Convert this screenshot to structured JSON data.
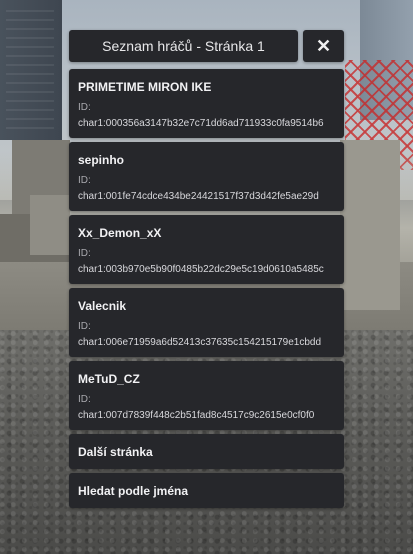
{
  "menu": {
    "title": "Seznam hráčů - Stránka 1",
    "close_icon": "close-icon",
    "close_glyph": "✕",
    "players": [
      {
        "name": "PRIMETIME MIRON IKE",
        "id_label": "ID:",
        "id": "char1:000356a3147b32e7c71dd6ad711933c0fa9514b6"
      },
      {
        "name": "sepinho",
        "id_label": "ID:",
        "id": "char1:001fe74cdce434be24421517f37d3d42fe5ae29d"
      },
      {
        "name": "Xx_Demon_xX",
        "id_label": "ID:",
        "id": "char1:003b970e5b90f0485b22dc29e5c19d0610a5485c"
      },
      {
        "name": "Valecnik",
        "id_label": "ID:",
        "id": "char1:006e71959a6d52413c37635c154215179e1cbdd"
      },
      {
        "name": "MeTuD_CZ",
        "id_label": "ID:",
        "id": "char1:007d7839f448c2b51fad8c4517c9c2615e0cf0f0"
      }
    ],
    "next_page_label": "Další stránka",
    "search_by_name_label": "Hledat podle jména"
  },
  "colors": {
    "panel": "#26272b",
    "text": "#f2f2f4",
    "muted_text": "#a9a9ae"
  }
}
